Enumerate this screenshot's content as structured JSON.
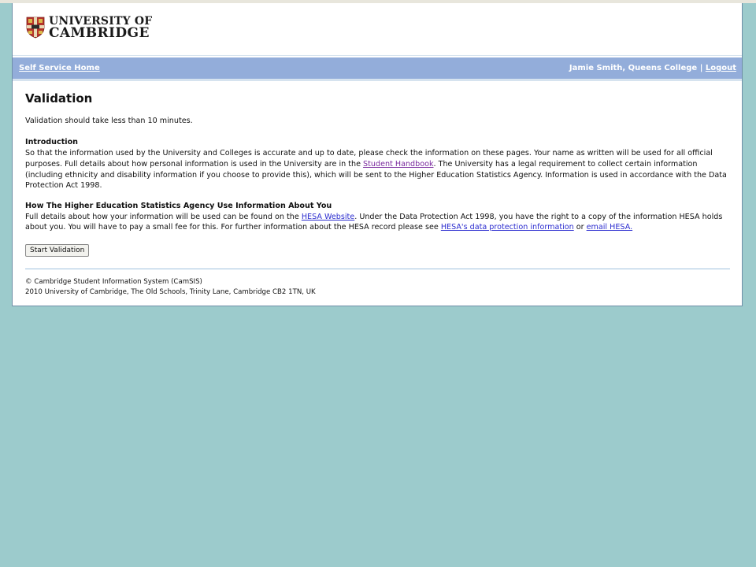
{
  "header": {
    "logo_line1": "UNIVERSITY OF",
    "logo_line2": "CAMBRIDGE",
    "crest_icon": "cambridge-crest-icon",
    "crest_color": "#b5332a"
  },
  "navbar": {
    "home_link": "Self Service Home",
    "user_info": "Jamie Smith, Queens College |",
    "logout_link": "Logout",
    "background": "#93adda"
  },
  "main": {
    "title": "Validation",
    "intro": "Validation should take less than 10 minutes.",
    "introduction": {
      "heading": "Introduction",
      "text_before_link": "So that the information used by the University and Colleges is accurate and up to date, please check the information on these pages. Your name as written will be used for all official purposes. Full details about how personal information is used in the University are in the ",
      "link": "Student Handbook",
      "text_after_link": ". The University has a legal requirement to collect certain information (including ethnicity and disability information if you choose to provide this), which will be sent to the Higher Education Statistics Agency. Information is used in accordance with the Data Protection Act 1998."
    },
    "hesa": {
      "heading": "How The Higher Education Statistics Agency Use Information About You",
      "text1": "Full details about how your information will be used can be found on the ",
      "link1": "HESA Website",
      "text2": ". Under the Data Protection Act 1998, you have the right to a copy of the information HESA holds about you. You will have to pay a small fee for this. For further information about the HESA record please see ",
      "link2": "HESA's data protection information",
      "text3": " or ",
      "link3": "email HESA."
    },
    "start_button": "Start Validation"
  },
  "footer": {
    "line1": "© Cambridge Student Information System (CamSIS)",
    "line2": "2010 University of Cambridge, The Old Schools, Trinity Lane, Cambridge CB2 1TN, UK"
  }
}
